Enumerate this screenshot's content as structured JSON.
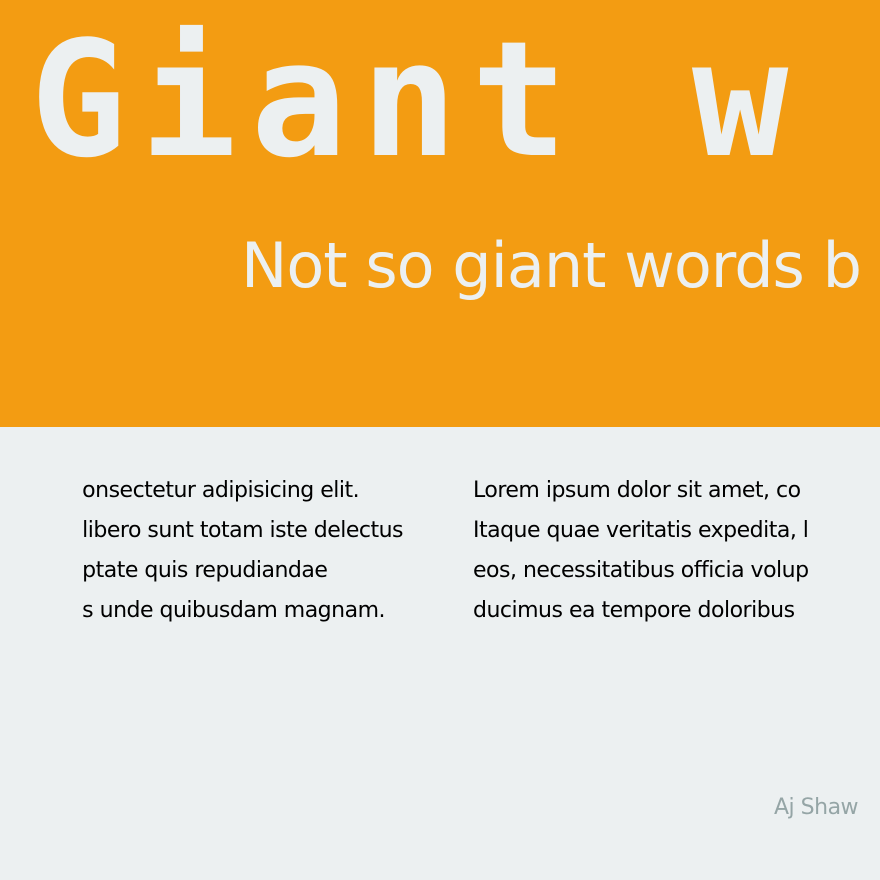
{
  "hero": {
    "title": "Giant w",
    "subtitle": "Not so giant words b"
  },
  "content": {
    "left_column": {
      "lines": [
        "onsectetur adipisicing elit.",
        " libero sunt totam iste delectus",
        "ptate quis repudiandae",
        "s unde quibusdam magnam."
      ]
    },
    "right_column": {
      "lines": [
        "Lorem ipsum dolor sit amet, co",
        "Itaque quae veritatis expedita, l",
        "eos, necessitatibus officia volup",
        "ducimus ea tempore doloribus"
      ]
    }
  },
  "footer": {
    "author": "Aj Shaw"
  },
  "colors": {
    "hero_background": "#f39c12",
    "page_background": "#ecf0f1",
    "hero_text": "#ecf0f1",
    "body_text": "#000000",
    "author_text": "#95a5a6"
  }
}
